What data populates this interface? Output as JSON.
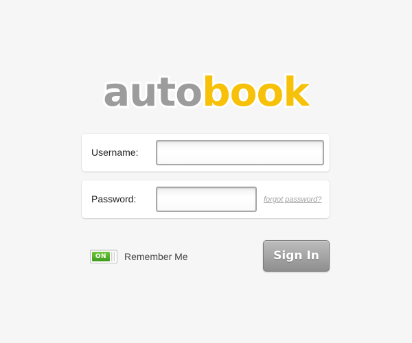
{
  "logo": {
    "part1": "auto",
    "part2": "book",
    "color_part1": "#9c9c9c",
    "color_part2": "#f7c10a"
  },
  "form": {
    "username_label": "Username:",
    "username_value": "",
    "password_label": "Password:",
    "password_value": "",
    "forgot_link": "forgot password?"
  },
  "remember": {
    "toggle_state": "ON",
    "label": "Remember Me"
  },
  "signin": {
    "label": "Sign In"
  },
  "colors": {
    "background": "#f6f6f6",
    "toggle_green": "#4aab24",
    "button_gray": "#9a9a9a"
  }
}
